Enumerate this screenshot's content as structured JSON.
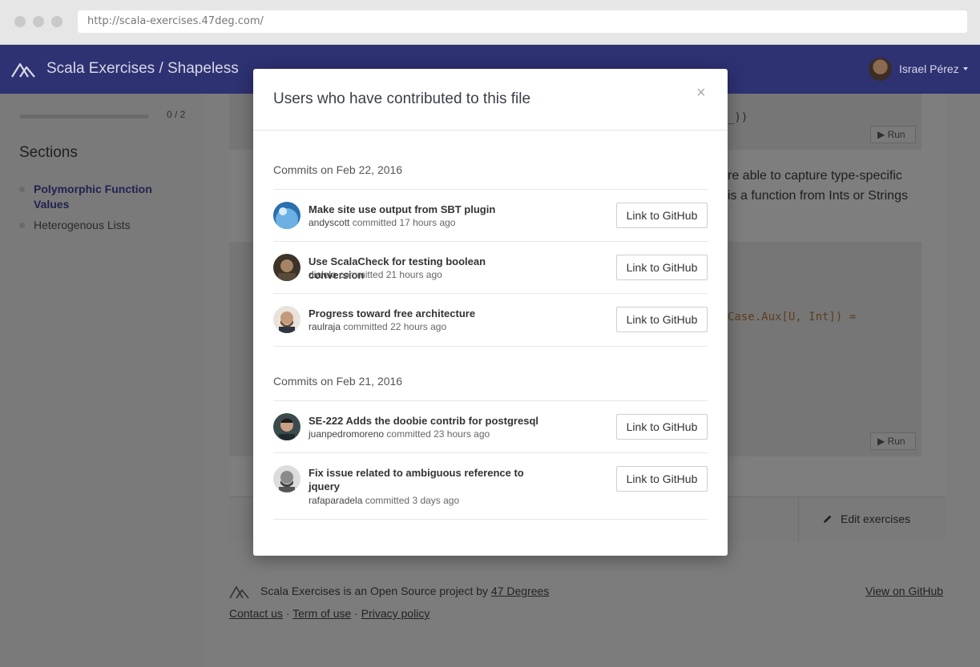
{
  "browser": {
    "url": "http://scala-exercises.47deg.com/"
  },
  "nav": {
    "brand": "Scala Exercises / Shapeless",
    "user_name": "Israel Pérez"
  },
  "sidebar": {
    "progress_text": "0 / 2",
    "progress_fraction": 0,
    "sections_title": "Sections",
    "items": [
      {
        "label": "Polymorphic Function Values",
        "active": true
      },
      {
        "label": "Heterogenous Lists",
        "active": false
      }
    ]
  },
  "content": {
    "code_fragment_1": "_))",
    "run_label": "Run",
    "para_line_1": "re able to capture type-specific",
    "para_line_2": "is a function from Ints or Strings",
    "code_fragment_2": "Case.Aux[U, Int]) =",
    "edit_label": "Edit exercises"
  },
  "footer": {
    "text_prefix": "Scala Exercises is an Open Source project by",
    "company_link": "47 Degrees",
    "contact": "Contact us",
    "terms": "Term of use",
    "privacy": "Privacy policy",
    "separator": "·",
    "github": "View on GitHub"
  },
  "modal": {
    "title": "Users who have contributed to this file",
    "close": "×",
    "committed_word": "committed",
    "button_label": "Link to GitHub",
    "groups": [
      {
        "date": "Commits on Feb 22, 2016",
        "commits": [
          {
            "message": "Make site use output from SBT plugin",
            "author": "andyscott",
            "time": "17 hours ago"
          },
          {
            "message": "Use ScalaCheck for testing boolean conversion",
            "author": "dialelo",
            "time": "21 hours ago"
          },
          {
            "message": "Progress toward free architecture",
            "author": "raulraja",
            "time": "22 hours ago"
          }
        ]
      },
      {
        "date": "Commits on Feb 21, 2016",
        "commits": [
          {
            "message": "SE-222 Adds the doobie contrib for postgresql",
            "author": "juanpedromoreno",
            "time": "23 hours ago"
          },
          {
            "message": "Fix issue related to ambiguous reference to jquery",
            "author": "rafaparadela",
            "time": "3 days ago"
          }
        ]
      }
    ]
  }
}
